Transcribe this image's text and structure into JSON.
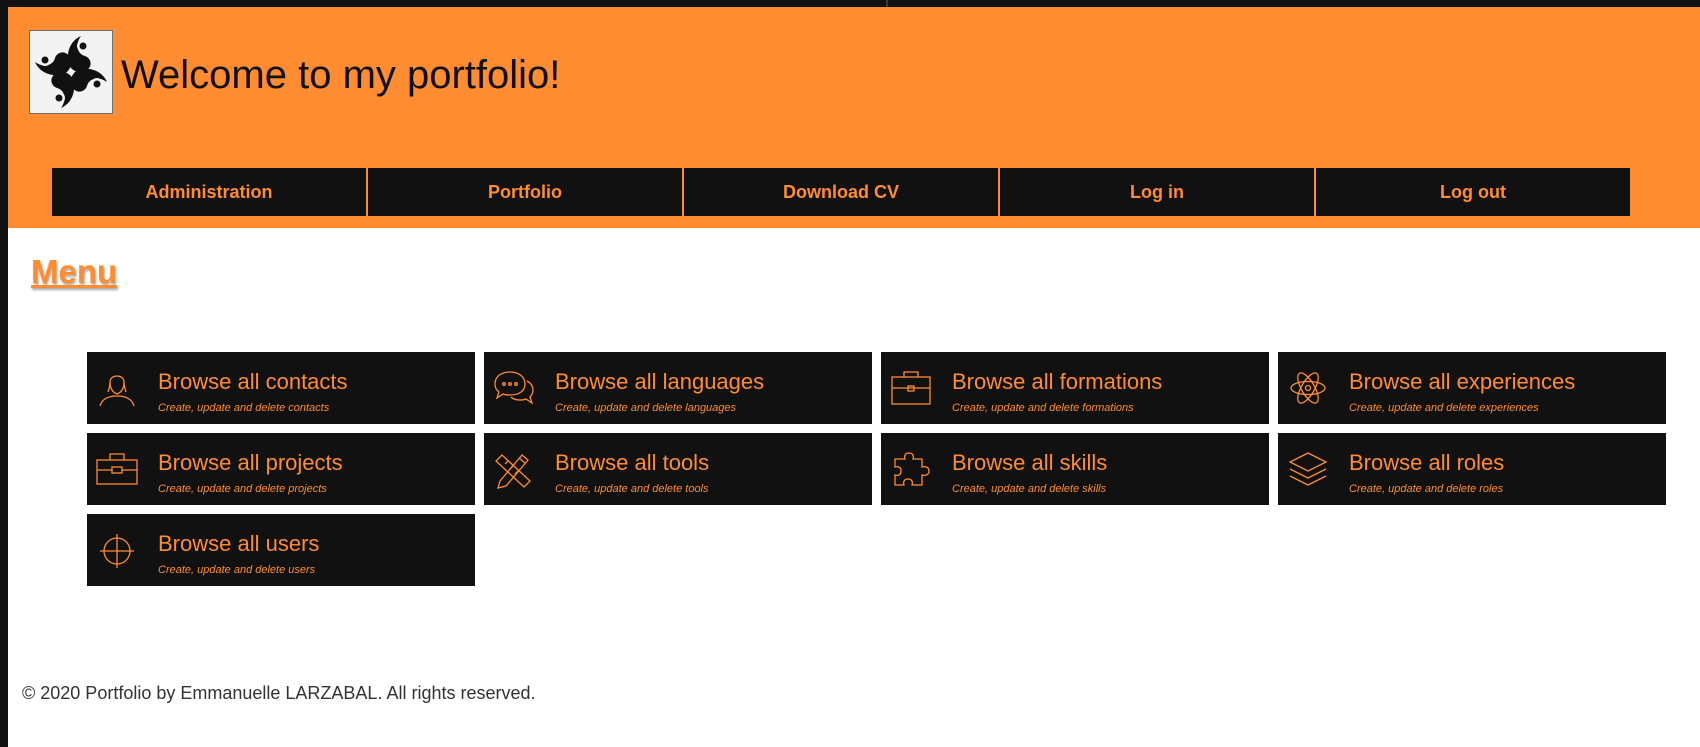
{
  "header": {
    "title": "Welcome to my portfolio!",
    "logo_icon": "lauburu-logo-icon"
  },
  "nav": {
    "items": [
      {
        "label": "Administration"
      },
      {
        "label": "Portfolio"
      },
      {
        "label": "Download CV"
      },
      {
        "label": "Log in"
      },
      {
        "label": "Log out"
      }
    ]
  },
  "main": {
    "heading": "Menu",
    "cards": [
      {
        "title": "Browse all contacts",
        "subtitle": "Create, update and delete contacts",
        "icon": "person-icon"
      },
      {
        "title": "Browse all languages",
        "subtitle": "Create, update and delete languages",
        "icon": "chat-bubbles-icon"
      },
      {
        "title": "Browse all formations",
        "subtitle": "Create, update and delete formations",
        "icon": "briefcase-icon"
      },
      {
        "title": "Browse all experiences",
        "subtitle": "Create, update and delete experiences",
        "icon": "atom-icon"
      },
      {
        "title": "Browse all projects",
        "subtitle": "Create, update and delete projects",
        "icon": "toolbox-icon"
      },
      {
        "title": "Browse all tools",
        "subtitle": "Create, update and delete tools",
        "icon": "pencil-ruler-icon"
      },
      {
        "title": "Browse all skills",
        "subtitle": "Create, update and delete skills",
        "icon": "puzzle-icon"
      },
      {
        "title": "Browse all roles",
        "subtitle": "Create, update and delete roles",
        "icon": "layers-icon"
      },
      {
        "title": "Browse all users",
        "subtitle": "Create, update and delete users",
        "icon": "crosshair-icon"
      }
    ]
  },
  "footer": {
    "text": "© 2020 Portfolio by Emmanuelle LARZABAL. All rights reserved."
  },
  "colors": {
    "accent": "#ff8c31",
    "dark": "#111111",
    "background": "#ffffff"
  }
}
